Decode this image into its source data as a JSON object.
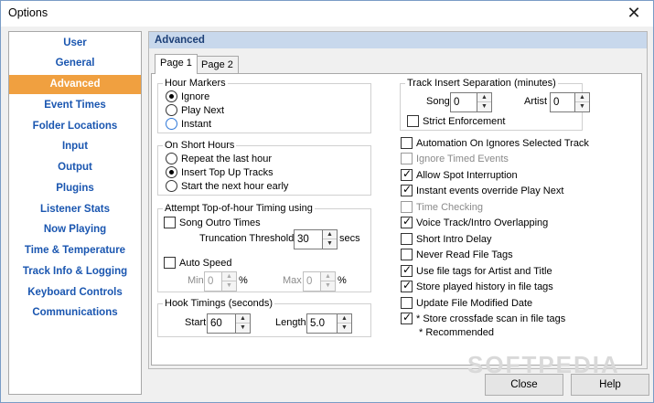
{
  "window": {
    "title": "Options",
    "close_glyph": "✕"
  },
  "sidebar": {
    "items": [
      {
        "label": "User"
      },
      {
        "label": "General"
      },
      {
        "label": "Advanced",
        "active": true
      },
      {
        "label": "Event Times"
      },
      {
        "label": "Folder Locations"
      },
      {
        "label": "Input"
      },
      {
        "label": "Output"
      },
      {
        "label": "Plugins"
      },
      {
        "label": "Listener Stats"
      },
      {
        "label": "Now Playing"
      },
      {
        "label": "Time & Temperature"
      },
      {
        "label": "Track Info & Logging"
      },
      {
        "label": "Keyboard Controls"
      },
      {
        "label": "Communications"
      }
    ]
  },
  "panel": {
    "header": "Advanced"
  },
  "tabs": [
    {
      "label": "Page 1",
      "active": true
    },
    {
      "label": "Page 2"
    }
  ],
  "hour_markers": {
    "label": "Hour Markers",
    "options": [
      "Ignore",
      "Play Next",
      "Instant"
    ],
    "selected": "Ignore"
  },
  "short_hours": {
    "label": "On Short Hours",
    "options": [
      "Repeat the last hour",
      "Insert Top Up Tracks",
      "Start the next hour early"
    ],
    "selected": "Insert Top Up Tracks"
  },
  "top_of_hour": {
    "label": "Attempt Top-of-hour Timing using",
    "song_outro": "Song Outro Times",
    "truncation_label": "Truncation Threshold",
    "truncation_value": "30",
    "truncation_unit": "secs",
    "auto_speed": "Auto Speed",
    "min_label": "Min",
    "min_value": "0",
    "max_label": "Max",
    "max_value": "0",
    "pct": "%"
  },
  "hook_timings": {
    "label": "Hook Timings (seconds)",
    "start_label": "Start",
    "start_value": "60",
    "length_label": "Length",
    "length_value": "5.0"
  },
  "separation": {
    "label": "Track Insert Separation (minutes)",
    "song_label": "Song",
    "song_value": "0",
    "artist_label": "Artist",
    "artist_value": "0",
    "strict": "Strict Enforcement"
  },
  "options": [
    {
      "label": "Automation On Ignores Selected Track",
      "checked": false,
      "disabled": false
    },
    {
      "label": "Ignore Timed Events",
      "checked": false,
      "disabled": true
    },
    {
      "label": "Allow Spot Interruption",
      "checked": true,
      "disabled": false
    },
    {
      "label": "Instant events override Play Next",
      "checked": true,
      "disabled": false
    },
    {
      "label": "Time Checking",
      "checked": false,
      "disabled": true
    },
    {
      "label": "Voice Track/Intro Overlapping",
      "checked": true,
      "disabled": false
    },
    {
      "label": "Short Intro Delay",
      "checked": false,
      "disabled": false
    },
    {
      "label": "Never Read File Tags",
      "checked": false,
      "disabled": false
    },
    {
      "label": "Use file tags for Artist and Title",
      "checked": true,
      "disabled": false
    },
    {
      "label": "Store played history in file tags",
      "checked": true,
      "disabled": false
    },
    {
      "label": "Update File Modified Date",
      "checked": false,
      "disabled": false
    },
    {
      "label": "* Store crossfade scan in file tags",
      "checked": true,
      "disabled": false
    }
  ],
  "recommended_note": "* Recommended",
  "buttons": {
    "close": "Close",
    "help": "Help"
  },
  "watermark": "SOFTPEDIA"
}
